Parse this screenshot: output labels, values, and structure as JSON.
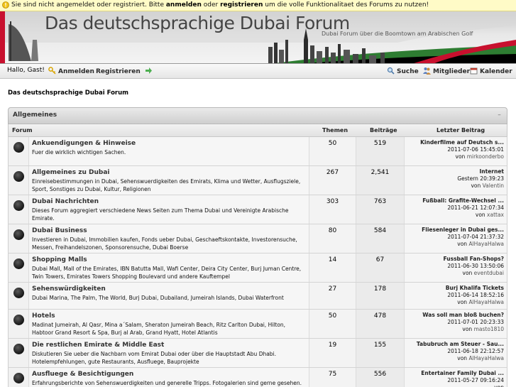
{
  "notice": {
    "part1": "Sie sind nicht angemeldet oder registriert. Bitte ",
    "login": "anmelden",
    "part2": " oder ",
    "register": "registrieren",
    "part3": " um die volle Funktionalitaet des Forums zu nutzen!"
  },
  "banner": {
    "title": "Das deutschsprachige Dubai Forum",
    "subtitle": "Dubai Forum über die Boomtown am Arabischen Golf"
  },
  "nav": {
    "greeting": "Hallo, Gast!",
    "login": "Anmelden",
    "register": "Registrieren",
    "search": "Suche",
    "members": "Mitglieder",
    "calendar": "Kalender"
  },
  "breadcrumb": "Das deutschsprachige Dubai Forum",
  "category": {
    "title": "Allgemeines",
    "collapse": "–"
  },
  "columns": {
    "forum": "Forum",
    "topics": "Themen",
    "posts": "Beiträge",
    "last": "Letzter Beitrag"
  },
  "forums": [
    {
      "name": "Ankuendigungen & Hinweise",
      "desc": "Fuer die wirklich wichtigen Sachen.",
      "topics": "50",
      "posts": "519",
      "last_title": "Kinderfilme auf Deutsch s...",
      "last_date": "2011-07-06 15:45:01",
      "last_by": "von",
      "last_user": "mirkoonderbo"
    },
    {
      "name": "Allgemeines zu Dubai",
      "desc": "Einreisebestimmungen in Dubai, Sehenswuerdigkeiten des Emirats, Klima und Wetter, Ausflugsziele, Sport, Sonstiges zu Dubai, Kultur, Religionen",
      "topics": "267",
      "posts": "2,541",
      "last_title": "Internet",
      "last_date": "Gestern 20:39:23",
      "last_by": "von",
      "last_user": "Valentin"
    },
    {
      "name": "Dubai Nachrichten",
      "desc": "Dieses Forum aggregiert verschiedene News Seiten zum Thema Dubai und Vereinigte Arabische Emirate.",
      "topics": "303",
      "posts": "763",
      "last_title": "Fußball: Grafite-Wechsel ...",
      "last_date": "2011-06-21 12:07:34",
      "last_by": "von",
      "last_user": "xattax"
    },
    {
      "name": "Dubai Business",
      "desc": "Investieren in Dubai, Immobilien kaufen, Fonds ueber Dubai, Geschaeftskontakte, Investorensuche, Messen, Freihandelszonen, Sponsorensuche, Dubai Boerse",
      "topics": "80",
      "posts": "584",
      "last_title": "Fliesenleger in Dubai ges...",
      "last_date": "2011-07-04 21:37:32",
      "last_by": "von",
      "last_user": "AlHayaHalwa"
    },
    {
      "name": "Shopping Malls",
      "desc": "Dubai Mall, Mall of the Emirates, IBN Batutta Mall, Wafi Center, Deira City Center, Burj Juman Centre, Twin Towers, Emirates Towers Shopping Boulevard und andere Kauftempel",
      "topics": "14",
      "posts": "67",
      "last_title": "Fussball Fan-Shops?",
      "last_date": "2011-06-30 13:50:06",
      "last_by": "von",
      "last_user": "eventdubai"
    },
    {
      "name": "Sehenswürdigkeiten",
      "desc": "Dubai Marina, The Palm, The World, Burj Dubai, Dubailand, Jumeirah Islands, Dubai Waterfront",
      "topics": "27",
      "posts": "178",
      "last_title": "Burj Khalifa Tickets",
      "last_date": "2011-06-14 18:52:16",
      "last_by": "von",
      "last_user": "AlHayaHalwa"
    },
    {
      "name": "Hotels",
      "desc": "Madinat Jumeirah, Al Qasr, Mina a´Salam, Sheraton Jumeirah Beach, Ritz Carlton Dubai, Hilton, Habtoor Grand Resort & Spa, Burj al Arab, Grand Hyatt, Hotel Atlantis",
      "topics": "50",
      "posts": "478",
      "last_title": "Was soll man bloß buchen?",
      "last_date": "2011-07-01 20:23:33",
      "last_by": "von",
      "last_user": "masto1810"
    },
    {
      "name": "Die restlichen Emirate & Middle East",
      "desc": "Diskutieren Sie ueber die Nachbarn vom Emirat Dubai oder über die Hauptstadt Abu Dhabi. Hotelempfehlungen, gute Restaurants, Ausfluege, Bauprojekte",
      "topics": "19",
      "posts": "155",
      "last_title": "Tabubruch am Steuer - Sau...",
      "last_date": "2011-06-18 22:12:57",
      "last_by": "von",
      "last_user": "AlHayaHalwa"
    },
    {
      "name": "Ausfluege & Besichtigungen",
      "desc": "Erfahrungsberichte von Sehenswuerdigkeiten und generelle Tripps. Fotogalerien sind gerne gesehen.",
      "topics": "75",
      "posts": "556",
      "last_title": "Entertainer Family Dubai ...",
      "last_date": "2011-05-27 09:16:24",
      "last_by": "von",
      "last_user": ""
    }
  ],
  "colors": {
    "accent": "#3a3a3a",
    "notice_bg": "#fffbc7",
    "link": "#2b2b2b"
  },
  "icons": [
    "warning-icon",
    "key-icon",
    "arrow-right-icon",
    "magnifier-icon",
    "members-icon",
    "calendar-icon",
    "forum-status-icon"
  ]
}
